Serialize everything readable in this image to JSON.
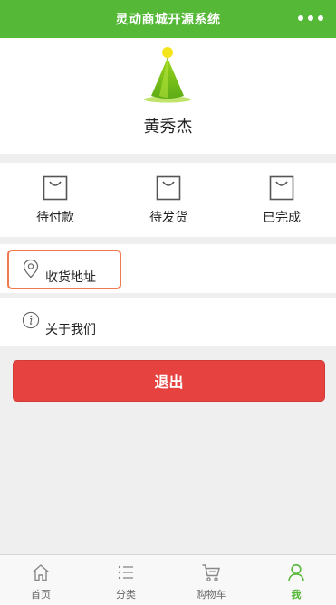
{
  "header": {
    "title": "灵动商城开源系统",
    "more_icon": "ellipsis-icon"
  },
  "profile": {
    "username": "黄秀杰",
    "avatar_icon": "green-tree-avatar"
  },
  "orders": [
    {
      "label": "待付款",
      "icon": "bag-icon"
    },
    {
      "label": "待发货",
      "icon": "bag-icon"
    },
    {
      "label": "已完成",
      "icon": "bag-icon"
    }
  ],
  "menu": {
    "address": {
      "label": "收货地址",
      "icon": "location-pin-icon"
    },
    "about": {
      "label": "关于我们",
      "icon": "info-icon"
    }
  },
  "logout_label": "退出",
  "tabbar": [
    {
      "label": "首页",
      "icon": "home-icon",
      "active": false
    },
    {
      "label": "分类",
      "icon": "list-icon",
      "active": false
    },
    {
      "label": "购物车",
      "icon": "cart-icon",
      "active": false
    },
    {
      "label": "我",
      "icon": "person-icon",
      "active": true
    }
  ],
  "colors": {
    "brand_green": "#55b837",
    "logout_red": "#e64340",
    "highlight_orange": "#ef7a4d"
  }
}
